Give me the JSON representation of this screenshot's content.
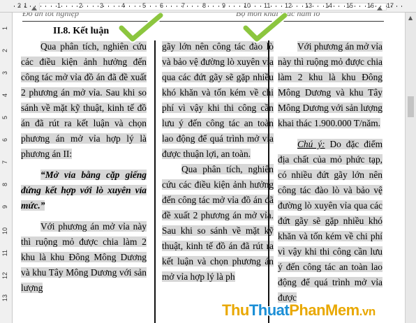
{
  "ruler": {
    "labels": [
      "2",
      "1",
      "1",
      "2",
      "3",
      "4",
      "5",
      "6",
      "7",
      "8",
      "9",
      "10",
      "11",
      "12",
      "13",
      "14",
      "15",
      "16",
      "17"
    ],
    "vlabels": [
      "1",
      "2",
      "3",
      "4",
      "5",
      "6",
      "7",
      "8",
      "9",
      "10",
      "11",
      "12",
      "13"
    ]
  },
  "header": {
    "left": "Đồ án tốt nghiệp",
    "right": "Bộ môn khai thác hầm lò"
  },
  "col1": {
    "title": "II.8. Kết luận",
    "p1": "Qua phân tích, nghiên cứu các điều kiện ảnh hưởng đến công tác mở vỉa đồ án đã đề xuất 2 phương án mở vỉa. Sau khi so sánh về mặt kỹ thuật, kinh tế đồ án đã rút ra kết luận và chọn phương án mở vỉa hợp lý là phương án II:",
    "p2": "“Mở vỉa bằng cặp giếng đứng kết hợp với lò xuyên vỉa mức.”",
    "p3": "Với phương án mở vỉa này thì ruộng mỏ được chia làm 2 khu là khu Đông Mông Dương và khu Tây Mông Dương với sản lượng"
  },
  "col2": {
    "p1": "gãy lớn nên công tác đào lò và bảo vệ đường lò xuyên vỉa qua các đứt gãy sẽ gặp nhiều khó khăn và tốn kém về chi phí vì vậy khi thi công cần lưu ý đến công tác an toàn lao động để quá trình mở vỉa được thuận lợi, an toàn.",
    "p2": "Qua phân tích, nghiên cứu các điều kiện ảnh hưởng đến công tác mở vỉa đồ án đã đề xuất 2 phương án mở vỉa. Sau khi so sánh về mặt kỹ thuật, kinh tế đồ án đã rút ra kết luận và chọn phương án mở vỉa hợp lý là ph"
  },
  "col3": {
    "p1": "Với phương án mở vỉa này thì ruộng mỏ được chia làm 2 khu là khu Đông Mông Dương và khu Tây Mông Dương với sản lượng khai thác 1.900.000 T/năm.",
    "note_label": "Chú ý:",
    "p2": " Do đặc điểm địa chất của mỏ phức tạp, có nhiều đứt gãy lớn nên công tác đào lò và bảo vệ đường lò xuyên vỉa qua các đứt gãy sẽ gặp nhiều khó khăn và tốn kém về chi phí vì vậy khi thi công cần lưu ý đến công tác an toàn lao động để quá trình mở vỉa được"
  },
  "watermark": {
    "part1": "Thu",
    "part2": "Thuat",
    "part3": "PhanMem",
    "part4": ".vn"
  },
  "colors": {
    "highlight": "#d7d7d7",
    "check": "#8cc63f",
    "watermark_orange": "#e9a800",
    "watermark_blue": "#1c8fd6"
  }
}
